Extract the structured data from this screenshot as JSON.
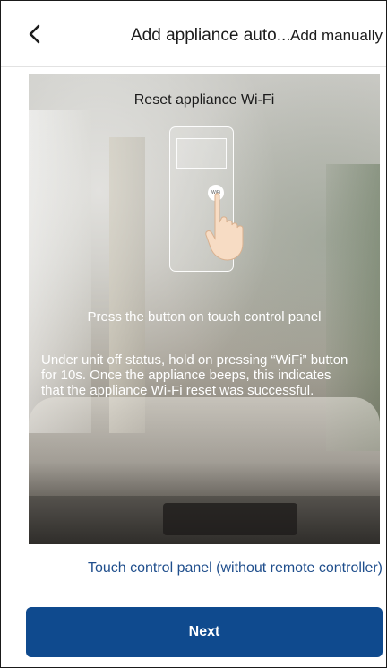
{
  "header": {
    "title": "Add appliance auto...",
    "add_manually_label": "Add manually",
    "back_icon": "chevron-left-icon"
  },
  "guide": {
    "title": "Reset appliance Wi-Fi",
    "wifi_button_label": "WiFi",
    "press_caption": "Press the button on touch control panel",
    "instruction": "Under unit off status, hold on pressing “WiFi” button for 10s. Once the appliance beeps, this indicates that the appliance Wi-Fi reset was successful.",
    "hand_icon": "pointing-hand-icon"
  },
  "mode_link_label": "Touch control panel (without remote controller)",
  "next_label": "Next",
  "colors": {
    "primary": "#0f4a8e",
    "link": "#1f4e8c",
    "text": "#1c1c1c"
  }
}
